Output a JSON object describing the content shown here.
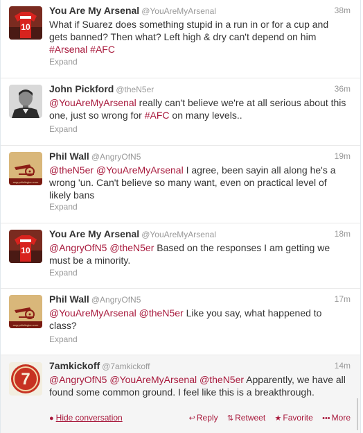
{
  "tweets": [
    {
      "name": "You Are My Arsenal",
      "handle": "@YouAreMyArsenal",
      "time": "38m",
      "avatar": "arsenal-shirt",
      "segments": [
        {
          "t": "What if Suarez does something stupid in a run in or for a cup and gets banned? Then what? Left high & dry can't depend on him "
        },
        {
          "t": "#Arsenal",
          "link": true
        },
        {
          "t": " "
        },
        {
          "t": "#AFC",
          "link": true
        }
      ],
      "expand": "Expand"
    },
    {
      "name": "John Pickford",
      "handle": "@theN5er",
      "time": "36m",
      "avatar": "bw-portrait",
      "segments": [
        {
          "t": "@YouAreMyArsenal",
          "link": true
        },
        {
          "t": " really can't believe we're at all serious about this one, just so wrong for "
        },
        {
          "t": "#AFC",
          "link": true
        },
        {
          "t": " on many levels.."
        }
      ],
      "expand": "Expand"
    },
    {
      "name": "Phil Wall",
      "handle": "@AngryOfN5",
      "time": "19m",
      "avatar": "cannon",
      "segments": [
        {
          "t": "@theN5er",
          "link": true
        },
        {
          "t": " "
        },
        {
          "t": "@YouAreMyArsenal",
          "link": true
        },
        {
          "t": " I agree, been sayin all along he's a wrong 'un. Can't believe so many want, even on practical level of likely bans"
        }
      ],
      "expand": "Expand"
    },
    {
      "name": "You Are My Arsenal",
      "handle": "@YouAreMyArsenal",
      "time": "18m",
      "avatar": "arsenal-shirt",
      "segments": [
        {
          "t": "@AngryOfN5",
          "link": true
        },
        {
          "t": " "
        },
        {
          "t": "@theN5er",
          "link": true
        },
        {
          "t": " Based on the responses I am getting we must be a minority."
        }
      ],
      "expand": "Expand"
    },
    {
      "name": "Phil Wall",
      "handle": "@AngryOfN5",
      "time": "17m",
      "avatar": "cannon",
      "segments": [
        {
          "t": "@YouAreMyArsenal",
          "link": true
        },
        {
          "t": " "
        },
        {
          "t": "@theN5er",
          "link": true
        },
        {
          "t": " Like you say, what happened to class?"
        }
      ],
      "expand": "Expand"
    },
    {
      "name": "7amkickoff",
      "handle": "@7amkickoff",
      "time": "14m",
      "avatar": "seven-logo",
      "segments": [
        {
          "t": "@AngryOfN5",
          "link": true
        },
        {
          "t": " "
        },
        {
          "t": "@YouAreMyArsenal",
          "link": true
        },
        {
          "t": " "
        },
        {
          "t": "@theN5er",
          "link": true
        },
        {
          "t": " Apparently, we have all found some common ground. I feel like this is a breakthrough."
        }
      ]
    }
  ],
  "avatar_text": {
    "shirt_number": "10",
    "seven": "7",
    "cannon_site": "angryofislington.com"
  },
  "actions": {
    "hide_conversation": "Hide conversation",
    "reply": "Reply",
    "retweet": "Retweet",
    "favorite": "Favorite",
    "more": "More"
  },
  "colors": {
    "link": "#a8193c",
    "meta": "#999999",
    "text": "#333333",
    "highlight_bg": "#f5f5f5"
  },
  "icons": {
    "reply": "reply-arrow-icon",
    "retweet": "retweet-icon",
    "favorite": "star-icon",
    "more": "more-dots-icon",
    "hide": "speech-bubble-icon"
  }
}
